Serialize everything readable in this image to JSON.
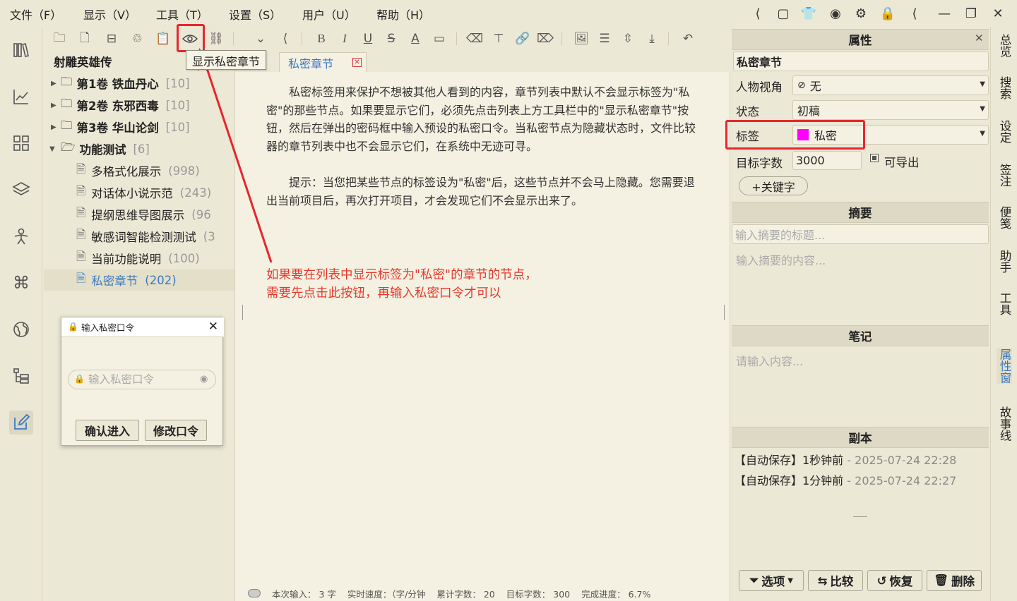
{
  "menu": [
    "文件（F）",
    "显示（V）",
    "工具（T）",
    "设置（S）",
    "用户（U）",
    "帮助（H）"
  ],
  "toolbar": {
    "tooltip": "显示私密章节"
  },
  "tree": {
    "book_title": "射雕英雄传",
    "volumes": [
      {
        "label": "第1卷  铁血丹心",
        "count": "[10]"
      },
      {
        "label": "第2卷  东邪西毒",
        "count": "[10]"
      },
      {
        "label": "第3卷  华山论剑",
        "count": "[10]"
      },
      {
        "label": "功能测试",
        "count": "[6]"
      }
    ],
    "chapters": [
      {
        "label": "多格式化展示",
        "count": "(998)"
      },
      {
        "label": "对话体小说示范",
        "count": "(243)"
      },
      {
        "label": "提纲思维导图展示",
        "count": "(96"
      },
      {
        "label": "敏感词智能检测测试",
        "count": "(3"
      },
      {
        "label": "当前功能说明",
        "count": "(100)"
      },
      {
        "label": "私密章节",
        "count": "(202)"
      }
    ]
  },
  "editor": {
    "tab_label": "私密章节",
    "paragraphs": [
      "私密标签用来保护不想被其他人看到的内容，章节列表中默认不会显示标签为\"私密\"的那些节点。如果要显示它们，必须先点击列表上方工具栏中的\"显示私密章节\"按钮，然后在弹出的密码框中输入预设的私密口令。当私密节点为隐藏状态时，文件比较器的章节列表中也不会显示它们，在系统中无迹可寻。",
      "提示：当您把某些节点的标签设为\"私密\"后，这些节点并不会马上隐藏。您需要退出当前项目后，再次打开项目，才会发现它们不会显示出来了。"
    ],
    "annotation_line1": "如果要在列表中显示标签为\"私密\"的章节的节点，",
    "annotation_line2": "需要先点击此按钮，再输入私密口令才可以",
    "status": [
      "本次输入：  3 字",
      "实时速度：（字/分钟",
      "累计字数：  20",
      "目标字数：  300",
      "完成进度：  6.7%"
    ]
  },
  "password_dialog": {
    "title": "输入私密口令",
    "placeholder": "输入私密口令",
    "confirm_label": "确认进入",
    "change_label": "修改口令"
  },
  "properties": {
    "header": "属性",
    "chapter_name": "私密章节",
    "pov_label": "人物视角",
    "pov_value": "无",
    "status_label": "状态",
    "status_value": "初稿",
    "tag_label": "标签",
    "tag_value": "私密",
    "tag_color": "#ff00ff",
    "target_label": "目标字数",
    "target_value": "3000",
    "exportable_label": "可导出",
    "keyword_button": "+关键字",
    "summary_header": "摘要",
    "summary_title_placeholder": "输入摘要的标题...",
    "summary_content_placeholder": "输入摘要的内容...",
    "notes_header": "笔记",
    "notes_placeholder": "请输入内容...",
    "copies_header": "副本",
    "copies": [
      {
        "label": "【自动保存】1秒钟前",
        "time": " - 2025-07-24 22:28"
      },
      {
        "label": "【自动保存】1分钟前",
        "time": " - 2025-07-24 22:27"
      }
    ],
    "buttons": {
      "options": "选项",
      "compare": "比较",
      "restore": "恢复",
      "delete": "删除"
    }
  },
  "right_tabs": [
    "总览",
    "搜索",
    "设定",
    "签注",
    "便笺",
    "助手",
    "工具",
    "属性窗",
    "故事线"
  ],
  "colors": {
    "accent": "#3b78c4",
    "highlight": "#e8262c",
    "annotation": "#e8392c"
  }
}
